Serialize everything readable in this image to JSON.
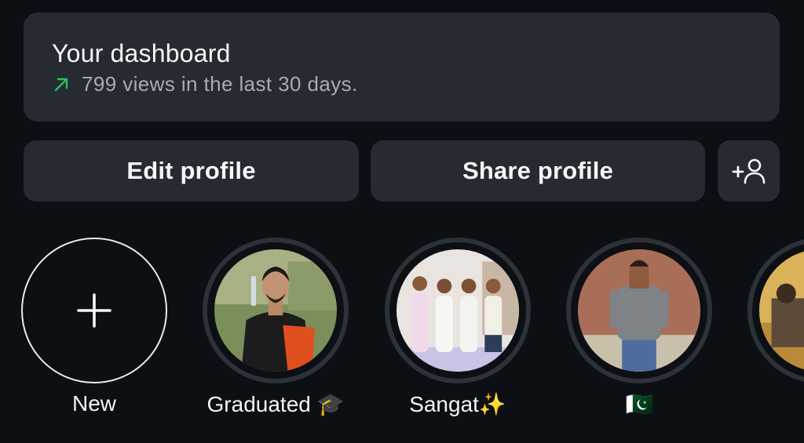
{
  "dashboard": {
    "title": "Your dashboard",
    "subtitle": "799 views in the last 30 days.",
    "trend_icon": "arrow-up-right-icon",
    "trend_color": "#22c55e"
  },
  "buttons": {
    "edit_label": "Edit profile",
    "share_label": "Share profile",
    "add_user_icon": "add-person-icon"
  },
  "highlights": [
    {
      "label": "New",
      "icon": "plus-icon"
    },
    {
      "label": "Graduated 🎓"
    },
    {
      "label": "Sangat✨"
    },
    {
      "label": "🇵🇰"
    }
  ],
  "colors": {
    "background": "#0c0f14",
    "card": "#262a31",
    "text_primary": "#f5f6f8",
    "text_secondary": "#a7acb5"
  }
}
